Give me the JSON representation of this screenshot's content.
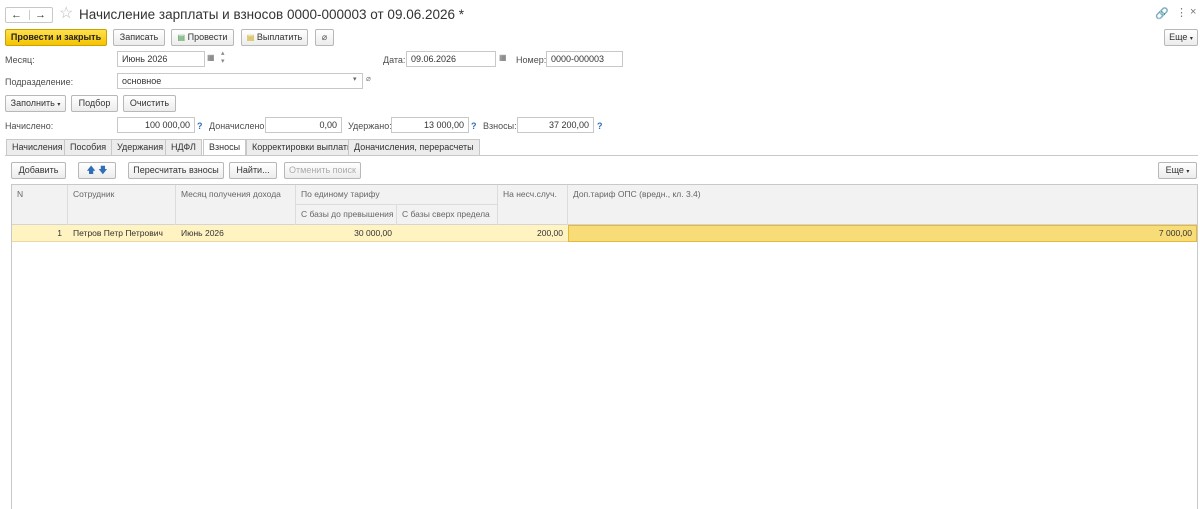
{
  "window": {
    "title": "Начисление зарплаты и взносов 0000-000003 от 09.06.2026 *"
  },
  "toolbar": {
    "post_and_close": "Провести и закрыть",
    "save": "Записать",
    "post": "Провести",
    "pay": "Выплатить",
    "more": "Еще"
  },
  "form": {
    "month_label": "Месяц:",
    "month_value": "Июнь 2026",
    "date_label": "Дата:",
    "date_value": "09.06.2026",
    "number_label": "Номер:",
    "number_value": "0000-000003",
    "dept_label": "Подразделение:",
    "dept_value": "основное",
    "fill_btn": "Заполнить",
    "select_btn": "Подбор",
    "clear_btn": "Очистить"
  },
  "totals": {
    "accrued_label": "Начислено:",
    "accrued_value": "100 000,00",
    "extra_label": "Доначислено:",
    "extra_value": "0,00",
    "withheld_label": "Удержано:",
    "withheld_value": "13 000,00",
    "contrib_label": "Взносы:",
    "contrib_value": "37 200,00",
    "q": "?"
  },
  "tabs": [
    "Начисления",
    "Пособия",
    "Удержания",
    "НДФЛ",
    "Взносы",
    "Корректировки выплаты",
    "Доначисления, перерасчеты"
  ],
  "table_toolbar": {
    "add": "Добавить",
    "recalc": "Пересчитать взносы",
    "find": "Найти...",
    "cancel_search": "Отменить поиск",
    "more": "Еще"
  },
  "table": {
    "headers": {
      "n": "N",
      "employee": "Сотрудник",
      "month": "Месяц получения дохода",
      "single_tariff": "По единому тарифу",
      "below_base": "С базы до превышения",
      "above_base": "С базы сверх предела",
      "accident": "На несч.случ.",
      "extra_ops": "Доп.тариф ОПС (вредн., кл. 3.4)"
    },
    "rows": [
      {
        "n": "1",
        "employee": "Петров Петр Петрович",
        "month": "Июнь 2026",
        "below_base": "30 000,00",
        "above_base": "",
        "accident": "200,00",
        "extra_ops": "7 000,00"
      }
    ]
  }
}
